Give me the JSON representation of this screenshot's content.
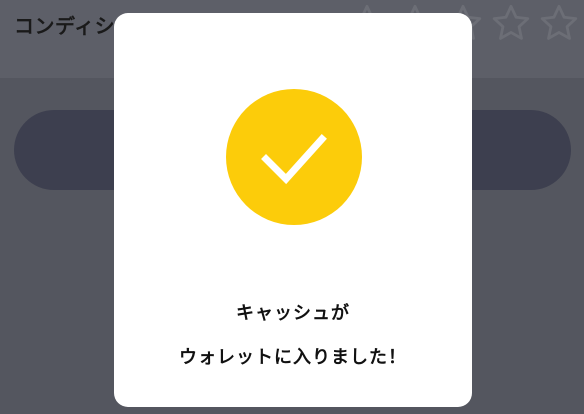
{
  "header": {
    "title": "コンディシ",
    "rating_icon": "star-outline-icon",
    "rating_value": 0,
    "rating_max": 5
  },
  "modal": {
    "icon": "check-icon",
    "icon_color": "#fccc0a",
    "message_line1": "キャッシュが",
    "message_line2": "ウォレットに入りました！"
  },
  "colors": {
    "overlay": "#54565f",
    "button": "#3d3f4f",
    "accent": "#fccc0a"
  }
}
